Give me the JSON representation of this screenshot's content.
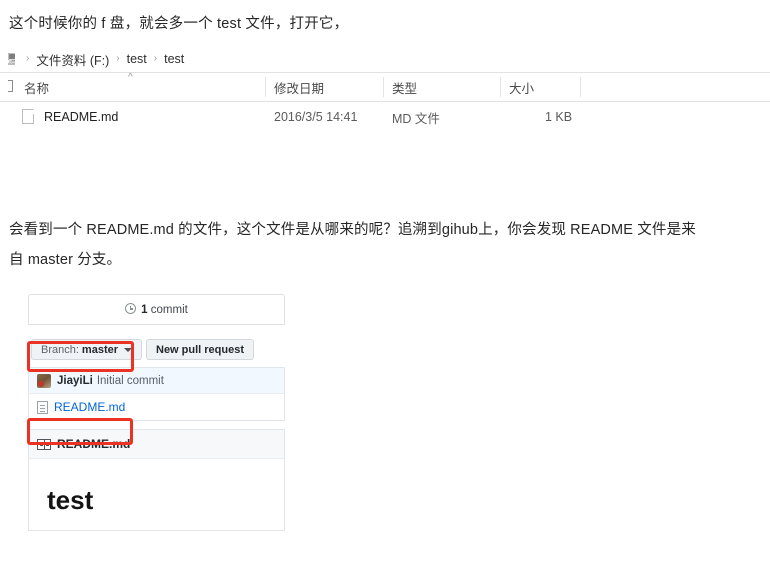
{
  "intro": {
    "text": "这个时候你的 f 盘，就会多一个 test 文件，打开它，"
  },
  "explorer": {
    "breadcrumb": {
      "lead_icon": "computer-icon",
      "separator": "›",
      "crumbs": [
        "文件资料 (F:)",
        "test",
        "test"
      ]
    },
    "sort_caret": "^",
    "columns": [
      {
        "label": "名称"
      },
      {
        "label": "修改日期"
      },
      {
        "label": "类型"
      },
      {
        "label": "大小"
      }
    ],
    "rows": [
      {
        "icon": "file-icon",
        "name": "README.md",
        "modified": "2016/3/5 14:41",
        "type": "MD 文件",
        "size": "1 KB"
      }
    ]
  },
  "body_paragraph": {
    "text": "会看到一个 README.md 的文件，这个文件是从哪来的呢？追溯到gihub上，你会发现 README 文件是来自 master 分支。"
  },
  "github": {
    "commit_bar": {
      "icon": "history-icon",
      "count": "1",
      "label": "commit"
    },
    "branch_button": {
      "prefix": "Branch:",
      "value": "master",
      "caret": "chevron-down-icon"
    },
    "pull_request_button": {
      "label": "New pull request"
    },
    "commit_row": {
      "avatar": "user-avatar",
      "author": "JiayiLi",
      "message": "Initial commit"
    },
    "file_row": {
      "icon": "document-icon",
      "name": "README.md"
    },
    "readme_panel": {
      "icon": "book-icon",
      "title": "README.md",
      "heading": "test"
    }
  },
  "annotations": {
    "highlight_color": "#ec3323",
    "boxes": [
      {
        "target": "branch-button"
      },
      {
        "target": "readme-file-link"
      }
    ]
  },
  "colors": {
    "link": "#0366d6",
    "commit_row_bg": "#f1f8ff",
    "panel_header_bg": "#f6f8fa",
    "border": "#e1e4e8"
  }
}
